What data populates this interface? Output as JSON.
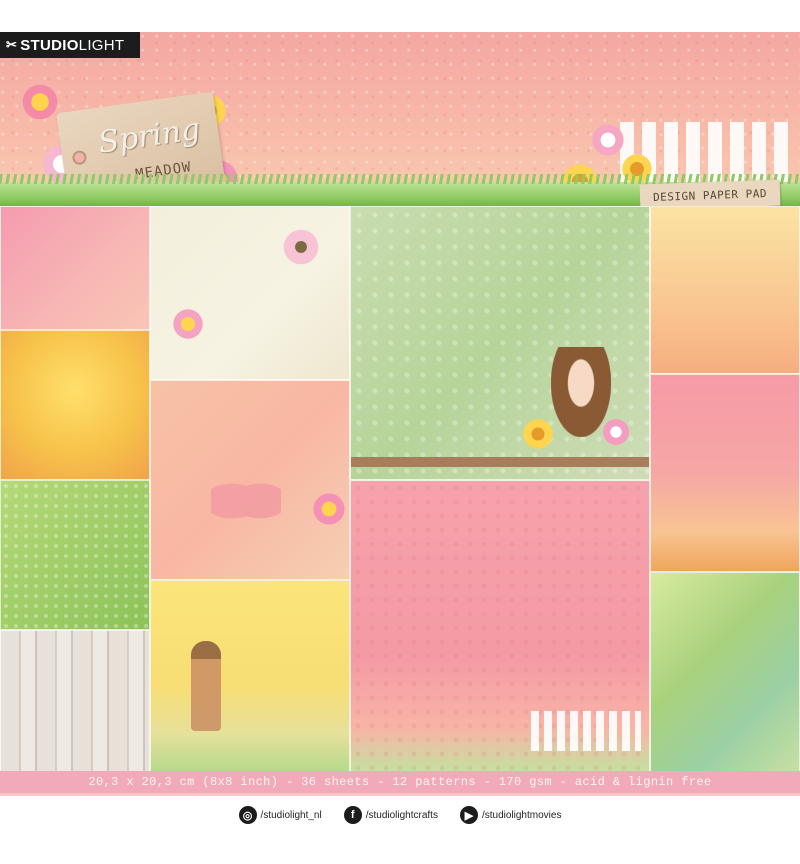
{
  "brand": {
    "name_bold": "STUDIO",
    "name_light": "LIGHT",
    "mark": "✂"
  },
  "cover": {
    "title_script": "Spring",
    "title_sub": "MEADOW",
    "product_type": "DESIGN PAPER PAD"
  },
  "specs_line": "20,3 x 20,3 cm (8x8 inch) - 36 sheets - 12 patterns - 170 gsm - acid & lignin free",
  "social": [
    {
      "icon": "instagram-icon",
      "glyph": "◎",
      "handle": "/studiolight_nl"
    },
    {
      "icon": "facebook-icon",
      "glyph": "f",
      "handle": "/studiolightcrafts"
    },
    {
      "icon": "youtube-icon",
      "glyph": "▶",
      "handle": "/studiolightmovies"
    }
  ],
  "colors": {
    "pink": "#f4a7a3",
    "grass": "#8fcb63",
    "band": "#f2a9b8",
    "tag": "#ead7c0"
  }
}
